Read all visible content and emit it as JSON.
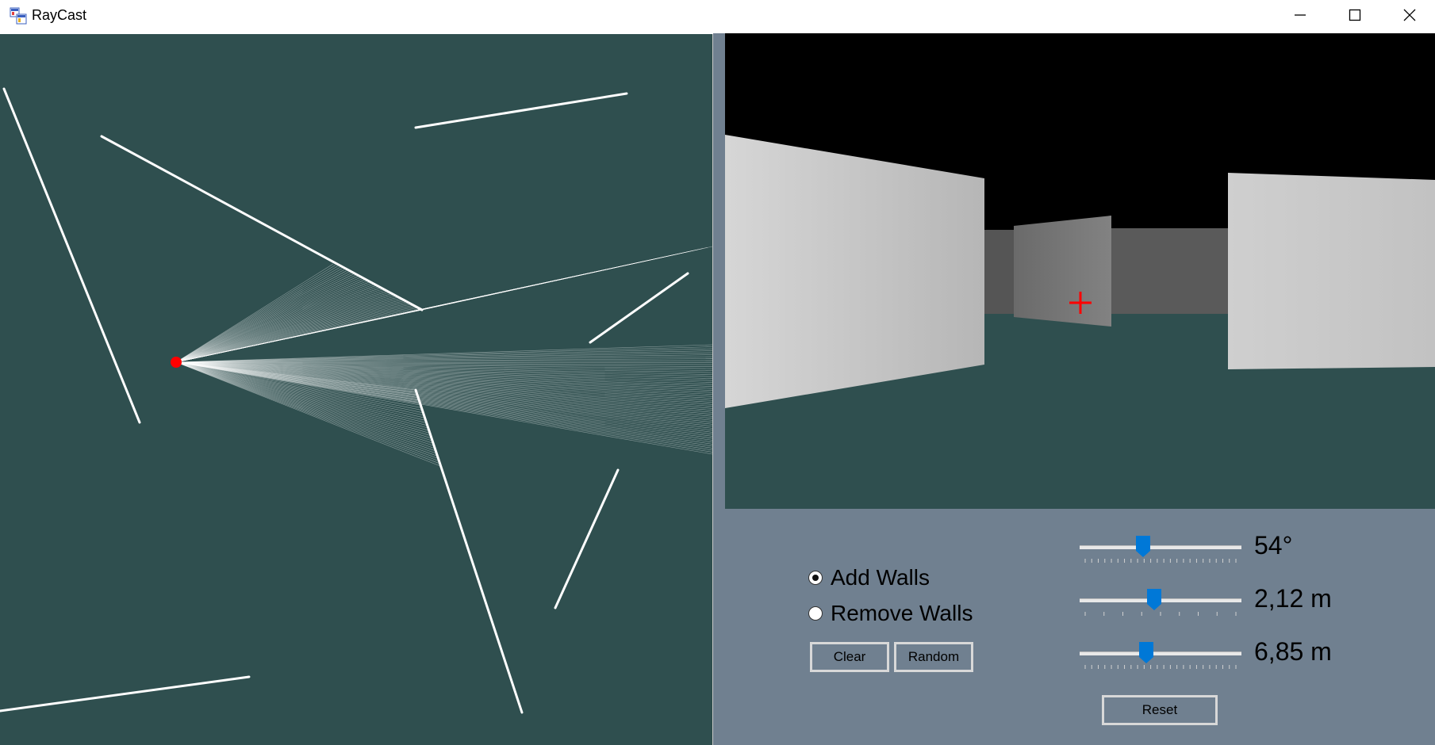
{
  "window": {
    "title": "RayCast",
    "controls": [
      "minimize",
      "maximize",
      "close"
    ]
  },
  "icons": {
    "app": "raycast-app-icon",
    "minimize": "minimize-icon",
    "maximize": "maximize-icon",
    "close": "close-icon",
    "crosshair": "crosshair-icon"
  },
  "colors": {
    "map_background": "#2f4f4f",
    "panel_background": "#708090",
    "sky": "#000000",
    "wall": "#ffffff",
    "player": "#ff0000",
    "crosshair": "#ff0000"
  },
  "mode": {
    "options": [
      {
        "label": "Add Walls",
        "checked": true
      },
      {
        "label": "Remove Walls",
        "checked": false
      }
    ]
  },
  "buttons": {
    "clear": "Clear",
    "random": "Random",
    "reset": "Reset"
  },
  "sliders": [
    {
      "value_label": "54°",
      "level": 0.39
    },
    {
      "value_label": "2,12 m",
      "level": 0.46
    },
    {
      "value_label": "6,85 m",
      "level": 0.41
    }
  ]
}
